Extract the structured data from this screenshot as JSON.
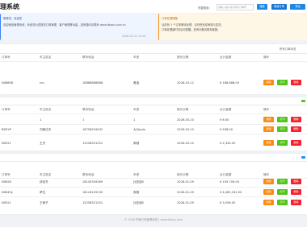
{
  "header": {
    "title": "理系统",
    "search_label": "快捷搜索：",
    "search_placeholder": "请输入用户名/手机/订单号",
    "btn1": "搜索",
    "btn2": "新建订单",
    "btn3": "导出"
  },
  "notice_blue": {
    "line1": "管理员，欢迎您",
    "line2": "欢迎使用管理系统，系统将为您提供订单管理、客户管理等功能，如有疑问请联系 www.dbsou.com.cn",
    "date": "2026-03-12 14:02"
  },
  "notice_orange": {
    "title": "订单处理提醒",
    "line1": "当前有 3 个订单等待处理，请尽快完成审核与发货。",
    "line2": "订单处理超时将自动提醒，如有问题请联系客服。"
  },
  "panel1": {
    "action_label": "所有订单状态",
    "columns": [
      "订单号",
      "车主姓名",
      "联系电话",
      "车型",
      "报价日期",
      "合计金额",
      "操作"
    ],
    "rows": [
      {
        "id": "N08808",
        "name": "ccc",
        "phone": "18888888888",
        "car": "奥迪",
        "date": "2026-03-12",
        "amount": "¥ 188,888.00"
      }
    ]
  },
  "panel2": {
    "columns": [
      "订单号",
      "车主姓名",
      "联系电话",
      "车型",
      "报价日期",
      "合计金额",
      "操作"
    ],
    "rows": [
      {
        "id": "",
        "name": "1",
        "phone": "1",
        "car": "1",
        "date": "2026-03-10",
        "amount": "¥ 6.00"
      },
      {
        "id": "BD5YP",
        "name": "刘家达夫",
        "phone": "18756254432",
        "car": "大众polo",
        "date": "2026-03-10",
        "amount": "¥ 558.00"
      },
      {
        "id": "N0521",
        "name": "王丹",
        "phone": "15258321251",
        "car": "奔驰",
        "date": "2026-03-10",
        "amount": "¥ 2,334.00"
      }
    ]
  },
  "panel3": {
    "columns": [
      "订单号",
      "车主姓名",
      "联系电话",
      "车型",
      "报价日期",
      "合计金额",
      "操作"
    ],
    "rows": [
      {
        "id": "N0828",
        "name": "钟佳东",
        "phone": "18145354369",
        "car": "比亚迪S",
        "date": "2026-01-09",
        "amount": "¥ 105,709.00"
      },
      {
        "id": "N0649y",
        "name": "萨达",
        "phone": "18145125230",
        "car": "奔驰",
        "date": "2026-01-09",
        "amount": "¥ 4,062,542.00"
      },
      {
        "id": "N0521",
        "name": "王家子",
        "phone": "15258321251",
        "car": "比亚迪S",
        "date": "2026-01-09",
        "amount": "¥ 3,556.00"
      }
    ]
  },
  "ops": {
    "edit": "编辑",
    "print": "打印",
    "delete": "删除"
  },
  "footer": "© 2026 车辆订单管理系统 | www.dbsou.com"
}
